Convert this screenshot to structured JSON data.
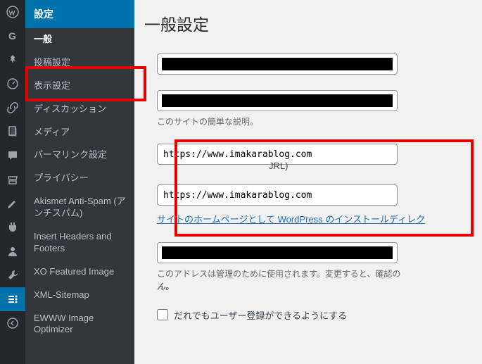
{
  "page": {
    "title": "一般設定"
  },
  "addressLabelPartial": "JRL)",
  "submenu": {
    "header": "設定",
    "items": [
      {
        "label": "一般",
        "active": true
      },
      {
        "label": "投稿設定"
      },
      {
        "label": "表示設定"
      },
      {
        "label": "ディスカッション"
      },
      {
        "label": "メディア"
      },
      {
        "label": "パーマリンク設定"
      },
      {
        "label": "プライバシー"
      },
      {
        "label": "Akismet Anti-Spam (アンチスパム)"
      },
      {
        "label": "Insert Headers and Footers"
      },
      {
        "label": "XO Featured Image"
      },
      {
        "label": "XML-Sitemap"
      },
      {
        "label": "EWWW Image Optimizer"
      }
    ]
  },
  "fields": {
    "tagline": {
      "description": "このサイトの簡単な説明。"
    },
    "wp_url": {
      "value": "https://www.imakarablog.com"
    },
    "site_url": {
      "value": "https://www.imakarablog.com",
      "help_link": "サイトのホームページとして WordPress のインストールディレク"
    },
    "admin_email": {
      "description_part1": "このアドレスは管理のために使用されます。変更すると、確認の",
      "description_part2": "ん。"
    },
    "membership": {
      "label": "だれでもユーザー登録ができるようにする"
    }
  },
  "iconbar": [
    {
      "name": "wordpress-icon"
    },
    {
      "name": "google-icon"
    },
    {
      "name": "pin-icon"
    },
    {
      "name": "dashboard-icon"
    },
    {
      "name": "link-icon"
    },
    {
      "name": "pages-icon"
    },
    {
      "name": "comments-icon"
    },
    {
      "name": "store-icon"
    },
    {
      "name": "appearance-icon"
    },
    {
      "name": "plugins-icon"
    },
    {
      "name": "users-icon"
    },
    {
      "name": "tools-icon"
    },
    {
      "name": "settings-icon",
      "selected": true
    },
    {
      "name": "collapse-icon"
    }
  ]
}
